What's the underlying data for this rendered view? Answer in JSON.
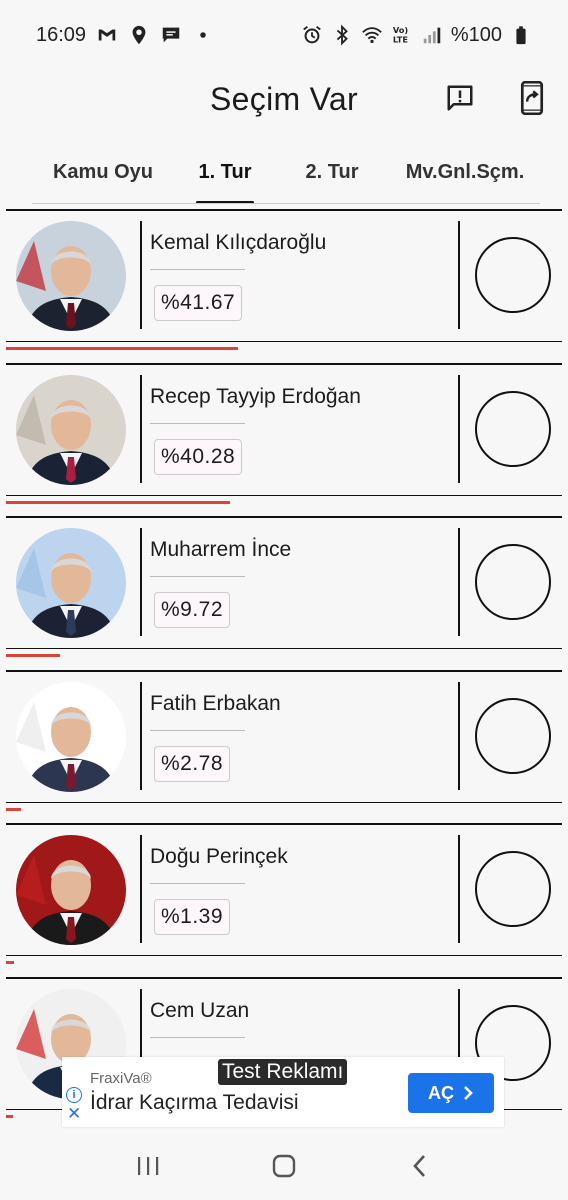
{
  "status_bar": {
    "time": "16:09",
    "battery": "%100",
    "icons_left": [
      "gmail-icon",
      "location-icon",
      "message-icon",
      "dot-icon"
    ],
    "icons_right": [
      "alarm-icon",
      "bluetooth-icon",
      "wifi-icon",
      "volte-icon",
      "signal-icon",
      "battery-icon"
    ],
    "volte_label": "Vo)\nLTE"
  },
  "app_bar": {
    "title": "Seçim Var",
    "actions": [
      "report-icon",
      "share-device-icon"
    ]
  },
  "tabs": [
    {
      "label": "Kamu Oyu",
      "active": false
    },
    {
      "label": "1. Tur",
      "active": true
    },
    {
      "label": "2. Tur",
      "active": false
    },
    {
      "label": "Mv.Gnl.Sçm.",
      "active": false
    }
  ],
  "candidates": [
    {
      "name": "Kemal Kılıçdaroğlu",
      "percent": "%41.67",
      "share": 0.4167,
      "photo_bg": "#c8d2dc",
      "suit": "#1d2230",
      "tie": "#6a1220",
      "accent": "#c0202a"
    },
    {
      "name": "Recep Tayyip Erdoğan",
      "percent": "%40.28",
      "share": 0.4028,
      "photo_bg": "#d9d4cc",
      "suit": "#1a2236",
      "tie": "#a82040",
      "accent": "#b8b0a4"
    },
    {
      "name": "Muharrem İnce",
      "percent": "%9.72",
      "share": 0.0972,
      "photo_bg": "#bcd4ee",
      "suit": "#1c2234",
      "tie": "#2a3b5c",
      "accent": "#9cc0e6"
    },
    {
      "name": "Fatih Erbakan",
      "percent": "%2.78",
      "share": 0.0278,
      "photo_bg": "#ffffff",
      "suit": "#2c3650",
      "tie": "#7a1a30",
      "accent": "#e8e8e8"
    },
    {
      "name": "Doğu Perinçek",
      "percent": "%1.39",
      "share": 0.0139,
      "photo_bg": "#a01818",
      "suit": "#1a1a1a",
      "tie": "#8a1520",
      "accent": "#c02020"
    },
    {
      "name": "Cem Uzan",
      "percent": "",
      "share": 0.012,
      "photo_bg": "#f0f0f0",
      "suit": "#1a2a44",
      "tie": "#222222",
      "accent": "#d02020"
    }
  ],
  "ad": {
    "label": "Test Reklamı",
    "advertiser": "FraxiVa®",
    "headline": "İdrar Kaçırma Tedavisi",
    "cta": "AÇ",
    "info_icon": "info-icon",
    "close_icon": "close-icon"
  },
  "navbar": [
    "recent-apps-icon",
    "home-icon",
    "back-icon"
  ]
}
